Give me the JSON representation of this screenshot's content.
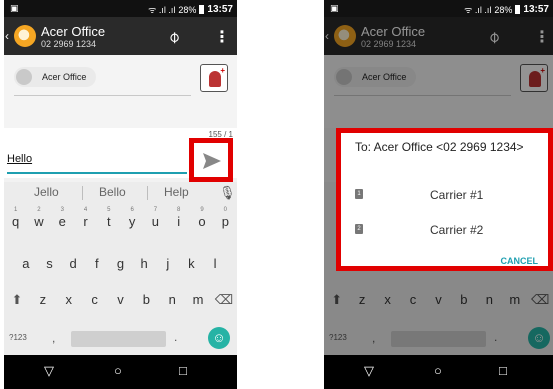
{
  "status_bar": {
    "time": "13:57",
    "battery": "28%"
  },
  "conversation": {
    "contact_name": "Acer Office",
    "contact_number": "02 2969 1234",
    "recipient_chip": "Acer Office"
  },
  "compose": {
    "char_counter": "155 / 1",
    "message_text": "Hello"
  },
  "keyboard": {
    "suggestions": [
      "Jello",
      "Bello",
      "Help"
    ],
    "row1": [
      "q",
      "w",
      "e",
      "r",
      "t",
      "y",
      "u",
      "i",
      "o",
      "p"
    ],
    "row1_nums": [
      "1",
      "2",
      "3",
      "4",
      "5",
      "6",
      "7",
      "8",
      "9",
      "0"
    ],
    "row2": [
      "a",
      "s",
      "d",
      "f",
      "g",
      "h",
      "j",
      "k",
      "l"
    ],
    "row3": [
      "z",
      "x",
      "c",
      "v",
      "b",
      "n",
      "m"
    ],
    "symbols_key": "?123",
    "comma_key": ",",
    "period_key": "."
  },
  "dialog": {
    "title": "To: Acer Office <02 2969 1234>",
    "options": [
      {
        "sim": "1",
        "label": "Carrier #1"
      },
      {
        "sim": "2",
        "label": "Carrier #2"
      }
    ],
    "cancel_label": "CANCEL"
  },
  "colors": {
    "accent": "#1e9fb0",
    "highlight": "#e10000",
    "emoji": "#26b3a5"
  },
  "icons": [
    "back-icon",
    "attach-icon",
    "overflow-icon",
    "send-icon",
    "mic-icon",
    "shift-icon",
    "backspace-icon",
    "emoji-icon",
    "nav-back-icon",
    "nav-home-icon",
    "nav-recents-icon",
    "sim-icon"
  ]
}
